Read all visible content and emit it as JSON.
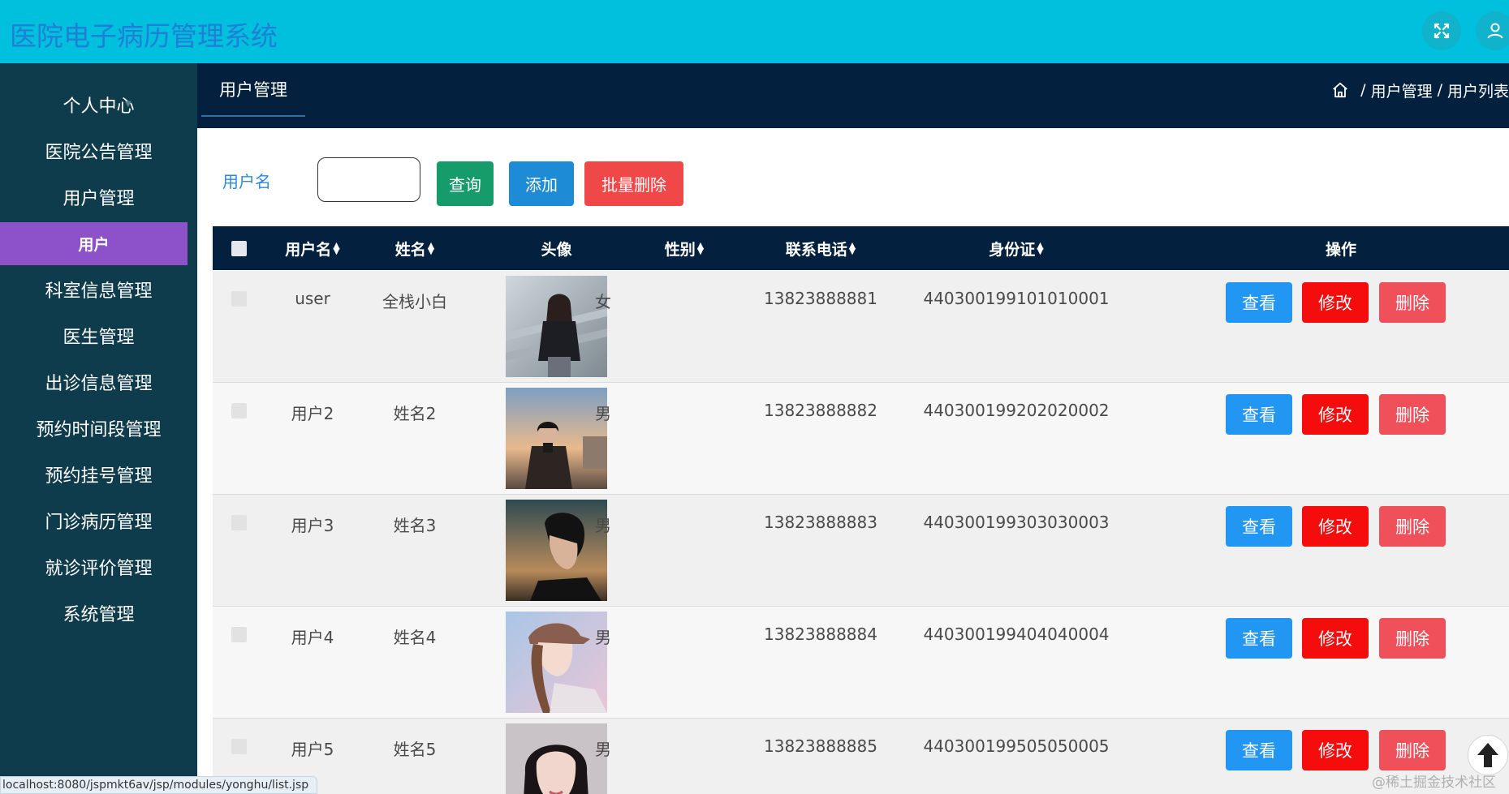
{
  "header": {
    "app_title": "医院电子病历管理系统",
    "fullscreen_icon": "expand-icon",
    "user_icon": "user-icon"
  },
  "sidebar": {
    "items": [
      {
        "label": "个人中心"
      },
      {
        "label": "医院公告管理"
      },
      {
        "label": "用户管理"
      },
      {
        "label": "用户",
        "active": true
      },
      {
        "label": "科室信息管理"
      },
      {
        "label": "医生管理"
      },
      {
        "label": "出诊信息管理"
      },
      {
        "label": "预约时间段管理"
      },
      {
        "label": "预约挂号管理"
      },
      {
        "label": "门诊病历管理"
      },
      {
        "label": "就诊评价管理"
      },
      {
        "label": "系统管理"
      }
    ]
  },
  "nav": {
    "page_tab": "用户管理",
    "breadcrumb": [
      "用户管理",
      "用户列表"
    ],
    "home_icon": "home-icon"
  },
  "search": {
    "label": "用户名",
    "value": "",
    "query_label": "查询",
    "add_label": "添加",
    "bulk_delete_label": "批量删除"
  },
  "table": {
    "columns": [
      "用户名",
      "姓名",
      "头像",
      "性别",
      "联系电话",
      "身份证",
      "操作"
    ],
    "rows": [
      {
        "username": "user",
        "name": "全栈小白",
        "gender": "女",
        "phone": "13823888881",
        "id_card": "440300199101010001"
      },
      {
        "username": "用户2",
        "name": "姓名2",
        "gender": "男",
        "phone": "13823888882",
        "id_card": "440300199202020002"
      },
      {
        "username": "用户3",
        "name": "姓名3",
        "gender": "男",
        "phone": "13823888883",
        "id_card": "440300199303030003"
      },
      {
        "username": "用户4",
        "name": "姓名4",
        "gender": "男",
        "phone": "13823888884",
        "id_card": "440300199404040004"
      },
      {
        "username": "用户5",
        "name": "姓名5",
        "gender": "男",
        "phone": "13823888885",
        "id_card": "440300199505050005"
      }
    ],
    "actions": {
      "view": "查看",
      "edit": "修改",
      "delete": "删除"
    }
  },
  "status_url": "localhost:8080/jspmkt6av/jsp/modules/yonghu/list.jsp",
  "watermark": "@稀土掘金技术社区",
  "colors": {
    "header_bg": "#00c0de",
    "sidebar_bg": "#0f3c4d",
    "active_item": "#8d52c9",
    "nav_band": "#03203f",
    "view_btn": "#2196f3",
    "edit_btn": "#f50c0c",
    "delete_btn": "#f0505a"
  }
}
